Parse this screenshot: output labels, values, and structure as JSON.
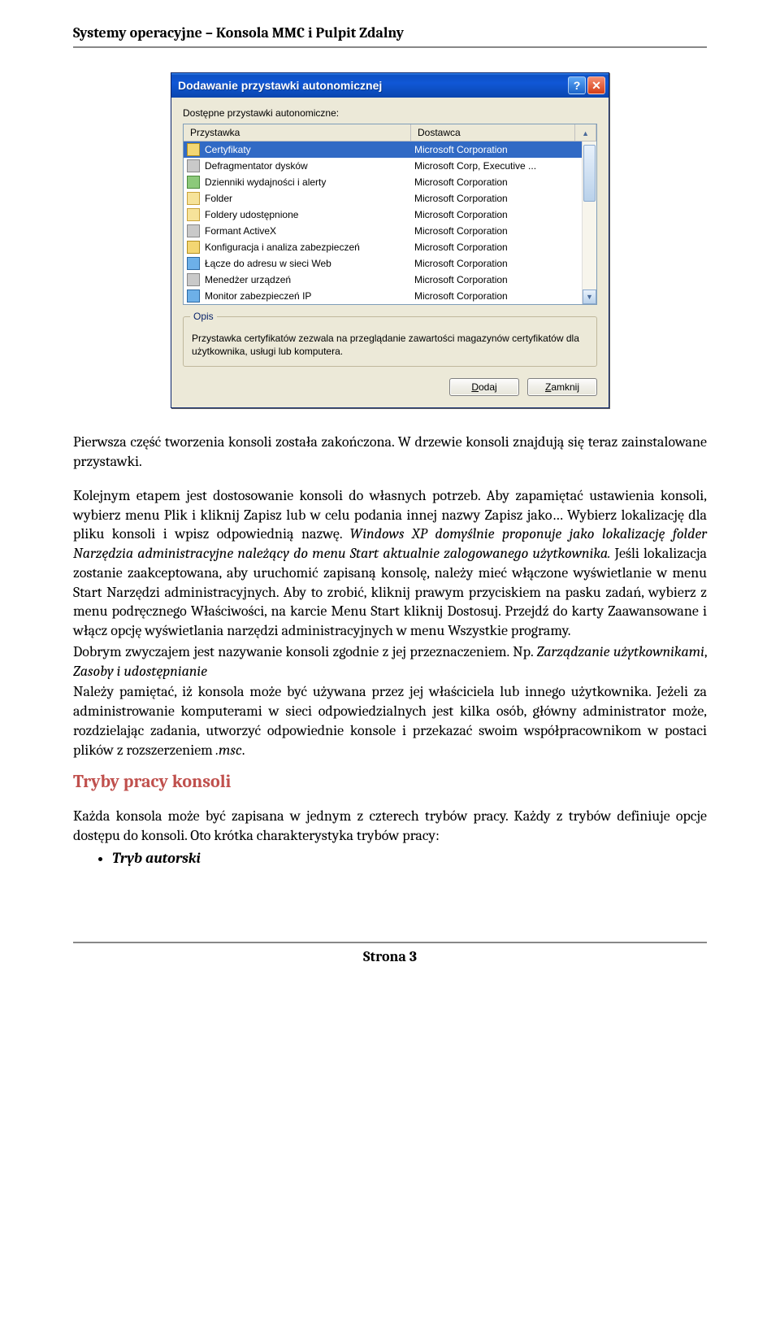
{
  "header": "Systemy operacyjne – Konsola MMC i Pulpit Zdalny",
  "dialog": {
    "title": "Dodawanie przystawki autonomicznej",
    "available_label": "Dostępne przystawki autonomiczne:",
    "col_snapin": "Przystawka",
    "col_vendor": "Dostawca",
    "rows": [
      {
        "name": "Certyfikaty",
        "vendor": "Microsoft Corporation",
        "selected": true,
        "icon": "ic-yellow"
      },
      {
        "name": "Defragmentator dysków",
        "vendor": "Microsoft Corp, Executive ...",
        "icon": "ic-grey"
      },
      {
        "name": "Dzienniki wydajności i alerty",
        "vendor": "Microsoft Corporation",
        "icon": "ic-green"
      },
      {
        "name": "Folder",
        "vendor": "Microsoft Corporation",
        "icon": "ic-folder"
      },
      {
        "name": "Foldery udostępnione",
        "vendor": "Microsoft Corporation",
        "icon": "ic-folder"
      },
      {
        "name": "Formant ActiveX",
        "vendor": "Microsoft Corporation",
        "icon": "ic-grey"
      },
      {
        "name": "Konfiguracja i analiza zabezpieczeń",
        "vendor": "Microsoft Corporation",
        "icon": "ic-yellow"
      },
      {
        "name": "Łącze do adresu w sieci Web",
        "vendor": "Microsoft Corporation",
        "icon": "ic-blue"
      },
      {
        "name": "Menedżer urządzeń",
        "vendor": "Microsoft Corporation",
        "icon": "ic-grey"
      },
      {
        "name": "Monitor zabezpieczeń IP",
        "vendor": "Microsoft Corporation",
        "icon": "ic-blue"
      }
    ],
    "desc_group": "Opis",
    "desc_text": "Przystawka certyfikatów zezwala na przeglądanie zawartości magazynów certyfikatów dla użytkownika, usługi lub komputera.",
    "btn_add_pre": "D",
    "btn_add_post": "odaj",
    "btn_close_pre": "Z",
    "btn_close_post": "amknij"
  },
  "para1": "Pierwsza część tworzenia konsoli została zakończona. W drzewie konsoli znajdują się teraz zainstalowane przystawki.",
  "para2a": "Kolejnym etapem jest dostosowanie konsoli do własnych potrzeb. Aby zapamiętać ustawienia konsoli, wybierz menu Plik i kliknij Zapisz lub w celu podania innej nazwy Zapisz jako… Wybierz lokalizację dla pliku konsoli i wpisz odpowiednią nazwę. ",
  "para2b": "Windows XP domyślnie proponuje jako lokalizację folder Narzędzia administracyjne należący do menu Start aktualnie zalogowanego użytkownika. ",
  "para2c": "Jeśli lokalizacja zostanie zaakceptowana, aby  uruchomić zapisaną konsolę, należy mieć włączone wyświetlanie w menu Start Narzędzi administracyjnych. Aby to zrobić, kliknij prawym przyciskiem na pasku zadań, wybierz z menu podręcznego Właściwości, na karcie Menu Start kliknij Dostosuj. Przejdź do karty Zaawansowane i włącz opcję wyświetlania narzędzi administracyjnych w menu Wszystkie programy.",
  "para3a": "Dobrym zwyczajem jest nazywanie konsoli zgodnie z jej przeznaczeniem. Np. ",
  "para3b": "Zarządzanie użytkownikami",
  "para3c": ", ",
  "para3d": "Zasoby i udostępnianie",
  "para4a": "Należy pamiętać, iż konsola może być używana przez jej właściciela lub innego użytkownika. Jeżeli za administrowanie komputerami w sieci odpowiedzialnych jest kilka osób, główny administrator może, rozdzielając zadania, utworzyć odpowiednie konsole i przekazać swoim współpracownikom w postaci plików z rozszerzeniem ",
  "para4b": ".msc",
  "para4c": ".",
  "heading": "Tryby pracy konsoli",
  "para5": "Każda konsola może być zapisana w jednym z czterech trybów pracy. Każdy z trybów definiuje opcje dostępu do konsoli. Oto krótka charakterystyka trybów pracy:",
  "bullet1": "Tryb autorski",
  "footer": "Strona 3"
}
